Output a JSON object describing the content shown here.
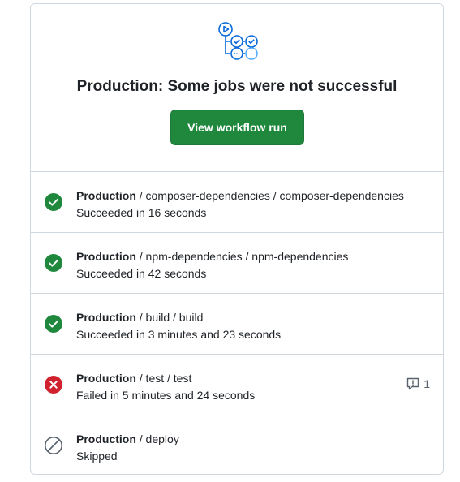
{
  "header": {
    "title": "Production: Some jobs were not successful",
    "button_label": "View workflow run",
    "graphic_icon": "workflow-graph-icon",
    "accent_color": "#0969da",
    "button_color": "#1f883d"
  },
  "jobs": [
    {
      "env": "Production",
      "path": " / composer-dependencies / composer-dependencies",
      "status": "Succeeded in 16 seconds",
      "state": "success",
      "icon": "check-circle-icon"
    },
    {
      "env": "Production",
      "path": " / npm-dependencies / npm-dependencies",
      "status": "Succeeded in 42 seconds",
      "state": "success",
      "icon": "check-circle-icon"
    },
    {
      "env": "Production",
      "path": " / build / build",
      "status": "Succeeded in 3 minutes and 23 seconds",
      "state": "success",
      "icon": "check-circle-icon"
    },
    {
      "env": "Production",
      "path": " / test / test",
      "status": "Failed in 5 minutes and 24 seconds",
      "state": "failure",
      "icon": "x-circle-icon",
      "annotation_count": "1",
      "annotation_icon": "comment-alert-icon"
    },
    {
      "env": "Production",
      "path": " / deploy",
      "status": "Skipped",
      "state": "skipped",
      "icon": "skip-icon"
    }
  ],
  "colors": {
    "success": "#1f883d",
    "failure": "#cf222e",
    "skipped": "#59636e",
    "border": "#d0d7de"
  }
}
